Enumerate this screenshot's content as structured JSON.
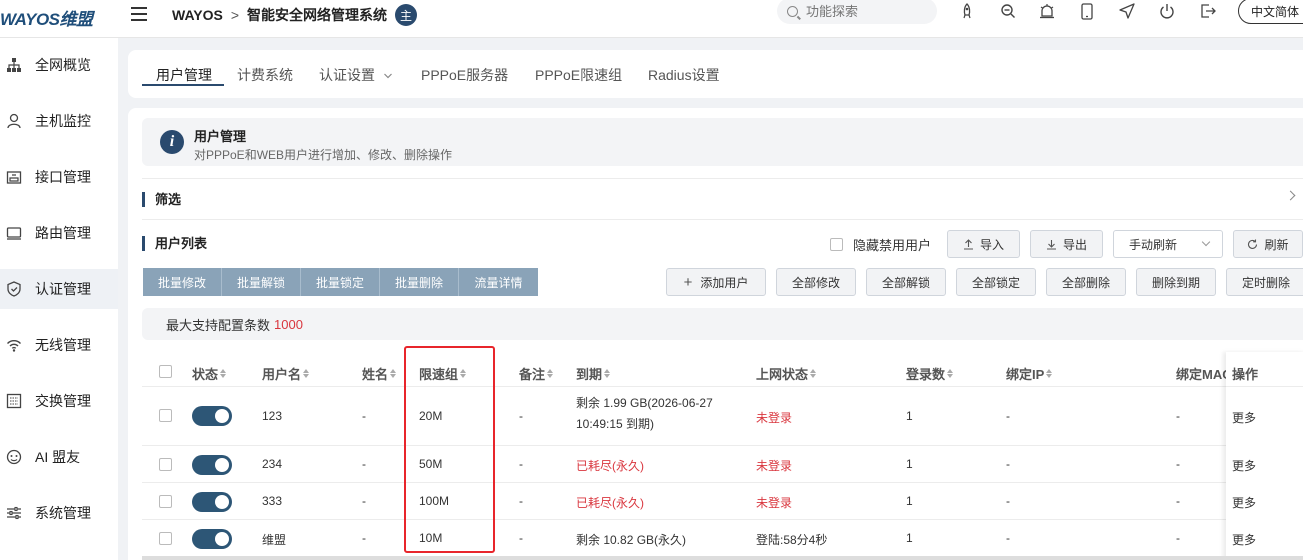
{
  "header": {
    "logo": "WAYOS维盟",
    "brand": "WAYOS",
    "separator": ">",
    "system_name": "智能安全网络管理系统",
    "badge": "主",
    "search_placeholder": "功能探索",
    "language": "中文简体"
  },
  "sidebar": {
    "items": [
      {
        "label": "全网概览",
        "icon": "topology-icon"
      },
      {
        "label": "主机监控",
        "icon": "user-icon"
      },
      {
        "label": "接口管理",
        "icon": "interface-icon"
      },
      {
        "label": "路由管理",
        "icon": "router-icon"
      },
      {
        "label": "认证管理",
        "icon": "shield-icon",
        "active": true
      },
      {
        "label": "无线管理",
        "icon": "wifi-icon"
      },
      {
        "label": "交换管理",
        "icon": "switch-icon"
      },
      {
        "label": "AI 盟友",
        "icon": "ai-icon"
      },
      {
        "label": "系统管理",
        "icon": "sliders-icon"
      }
    ]
  },
  "tabs": [
    "用户管理",
    "计费系统",
    "认证设置",
    "PPPoE服务器",
    "PPPoE限速组",
    "Radius设置"
  ],
  "info": {
    "title": "用户管理",
    "desc": "对PPPoE和WEB用户进行增加、修改、删除操作"
  },
  "filter_title": "筛选",
  "list_title": "用户列表",
  "toolbar": {
    "hide_disabled": "隐藏禁用用户",
    "import": "导入",
    "export": "导出",
    "refresh_mode": "手动刷新",
    "refresh": "刷新"
  },
  "batch": [
    "批量修改",
    "批量解锁",
    "批量锁定",
    "批量删除",
    "流量详情"
  ],
  "actions": [
    "添加用户",
    "全部修改",
    "全部解锁",
    "全部锁定",
    "全部删除",
    "删除到期",
    "定时删除"
  ],
  "max_config": {
    "label": "最大支持配置条数",
    "value": "1000"
  },
  "table": {
    "headers": [
      "状态",
      "用户名",
      "姓名",
      "限速组",
      "备注",
      "到期",
      "上网状态",
      "登录数",
      "绑定IP",
      "绑定MAC",
      "操作"
    ],
    "rows": [
      {
        "username": "123",
        "name": "-",
        "group": "20M",
        "note": "-",
        "expire": "剩余 1.99 GB(2026-06-27 10:49:15 到期)",
        "expire_red": false,
        "status": "未登录",
        "status_red": true,
        "logins": "1",
        "ip": "-",
        "mac": "-",
        "op": "更多",
        "enabled": true
      },
      {
        "username": "234",
        "name": "-",
        "group": "50M",
        "note": "-",
        "expire": "已耗尽(永久)",
        "expire_red": true,
        "status": "未登录",
        "status_red": true,
        "logins": "1",
        "ip": "-",
        "mac": "-",
        "op": "更多",
        "enabled": true
      },
      {
        "username": "333",
        "name": "-",
        "group": "100M",
        "note": "-",
        "expire": "已耗尽(永久)",
        "expire_red": true,
        "status": "未登录",
        "status_red": true,
        "logins": "1",
        "ip": "-",
        "mac": "-",
        "op": "更多",
        "enabled": true
      },
      {
        "username": "维盟",
        "name": "-",
        "group": "10M",
        "note": "-",
        "expire": "剩余 10.82 GB(永久)",
        "expire_red": false,
        "status": "登陆:58分4秒",
        "status_red": false,
        "logins": "1",
        "ip": "-",
        "mac": "-",
        "op": "更多",
        "enabled": true
      }
    ]
  }
}
